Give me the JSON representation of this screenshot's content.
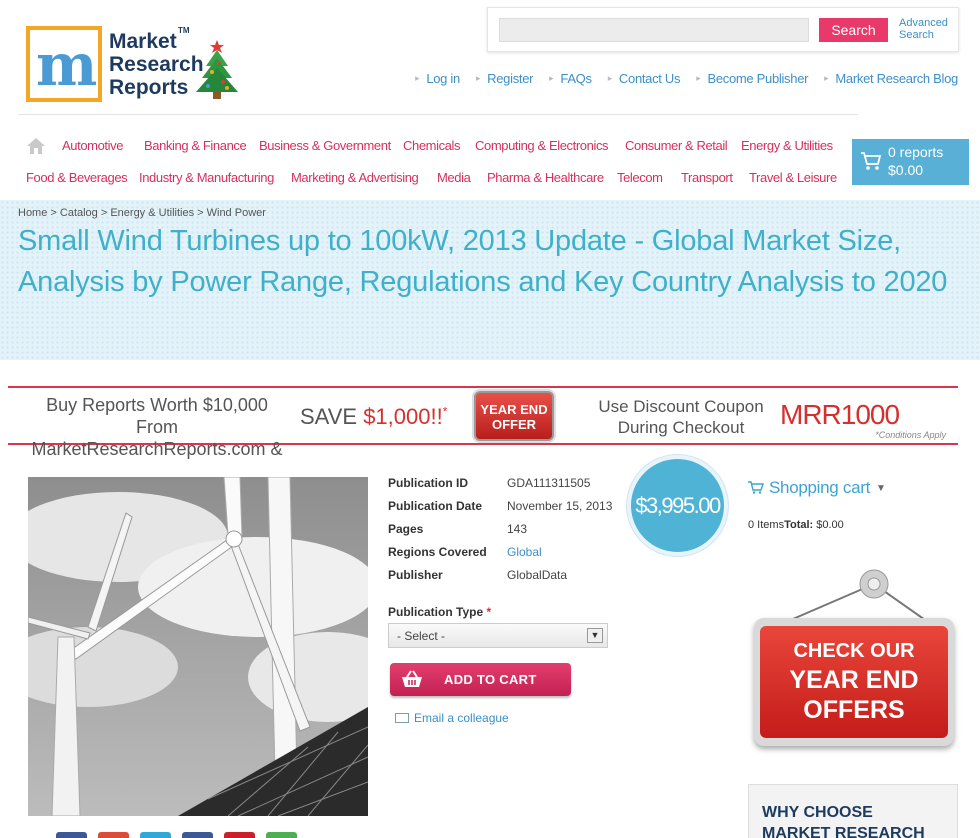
{
  "logo": {
    "m_letter": "m",
    "line1": "Market",
    "line2": "Research",
    "line3": "Reports",
    "tm": "TM"
  },
  "search": {
    "placeholder": "",
    "button_label": "Search",
    "advanced_line1": "Advanced",
    "advanced_line2": "Search"
  },
  "top_nav": [
    {
      "label": "Log in"
    },
    {
      "label": "Register"
    },
    {
      "label": "FAQs"
    },
    {
      "label": "Contact Us"
    },
    {
      "label": "Become Publisher"
    },
    {
      "label": "Market Research Blog"
    }
  ],
  "categories_row1": [
    {
      "label": "Automotive"
    },
    {
      "label": "Banking & Finance"
    },
    {
      "label": "Business & Government"
    },
    {
      "label": "Chemicals"
    },
    {
      "label": "Computing & Electronics"
    },
    {
      "label": "Consumer & Retail"
    },
    {
      "label": "Energy & Utilities"
    }
  ],
  "categories_row2": [
    {
      "label": "Food & Beverages"
    },
    {
      "label": "Industry & Manufacturing"
    },
    {
      "label": "Marketing & Advertising"
    },
    {
      "label": "Media"
    },
    {
      "label": "Pharma & Healthcare"
    },
    {
      "label": "Telecom"
    },
    {
      "label": "Transport"
    },
    {
      "label": "Travel & Leisure"
    }
  ],
  "cart": {
    "count_label": "0 reports",
    "total": "$0.00"
  },
  "breadcrumb": "Home > Catalog > Energy & Utilities > Wind Power",
  "title": "Small Wind Turbines up to 100kW, 2013 Update - Global Market Size, Analysis by Power Range, Regulations and Key Country Analysis to 2020",
  "promo": {
    "line1": "Buy Reports Worth $10,000 From",
    "line2": "MarketResearchReports.com &",
    "save_prefix": "SAVE",
    "save_amount": "$1,000!!",
    "save_mark": "*",
    "offer_line1": "YEAR END",
    "offer_line2": "OFFER",
    "coupon_line1": "Use Discount Coupon",
    "coupon_line2": "During Checkout",
    "code": "MRR1000",
    "conditions": "*Conditions Apply"
  },
  "details": {
    "rows": [
      {
        "label": "Publication ID",
        "value": "GDA111311505"
      },
      {
        "label": "Publication Date",
        "value": "November 15, 2013"
      },
      {
        "label": "Pages",
        "value": "143"
      },
      {
        "label": "Regions Covered",
        "value": "Global"
      },
      {
        "label": "Publisher",
        "value": "GlobalData"
      }
    ],
    "price": "$3,995.00",
    "pubtype_label": "Publication Type",
    "required_mark": "*",
    "select_value": "- Select -",
    "add_to_cart": "ADD TO CART",
    "email_colleague": "Email a colleague"
  },
  "sidebar": {
    "shopping_cart_title": "Shopping cart",
    "items_label": "0 Items",
    "total_label": "Total:",
    "total_value": "$0.00",
    "sign_line1": "CHECK OUR",
    "sign_line2": "YEAR END",
    "sign_line3": "OFFERS",
    "why_line1": "WHY CHOOSE",
    "why_line2": "MARKET RESEARCH"
  },
  "colors": {
    "accent_pink": "#e8396a",
    "link_blue": "#3d8fc6",
    "title_blue": "#3fb0c9",
    "category_red": "#d6305c",
    "cart_blue": "#58b0d6"
  }
}
